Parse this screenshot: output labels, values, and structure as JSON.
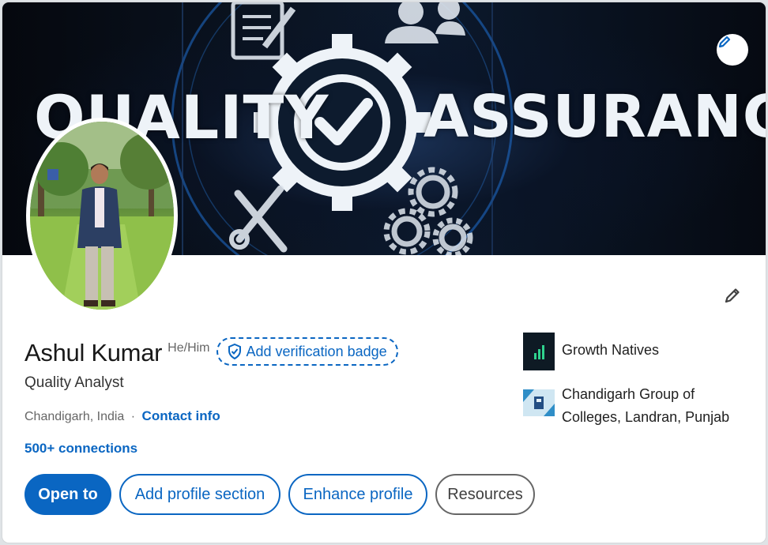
{
  "banner": {
    "word_left": "QUALITY",
    "word_right": "ASSURANCE"
  },
  "profile": {
    "name": "Ashul Kumar",
    "pronouns": "He/Him",
    "verify_label": "Add verification badge",
    "headline": "Quality Analyst",
    "location": "Chandigarh, India",
    "separator": "·",
    "contact_label": "Contact info",
    "connections": "500+ connections"
  },
  "orgs": [
    {
      "name": "Growth Natives",
      "icon": "company-logo"
    },
    {
      "name": "Chandigarh Group of Colleges, Landran, Punjab",
      "icon": "college-logo"
    }
  ],
  "actions": {
    "open_to": "Open to",
    "add_section": "Add profile section",
    "enhance": "Enhance profile",
    "resources": "Resources"
  },
  "colors": {
    "accent": "#0a66c2",
    "text": "#191919",
    "muted": "#666666"
  }
}
